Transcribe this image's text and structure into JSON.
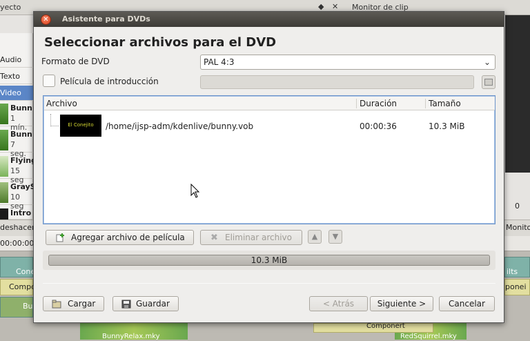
{
  "background": {
    "project_title": "yecto",
    "monitor_title": "Monitor de clip",
    "sidebar_items": [
      "Audio",
      "Texto",
      "Video"
    ],
    "clips": [
      {
        "name": "Bunn",
        "duration": "1 mín."
      },
      {
        "name": "Bunn",
        "duration": "7 seg."
      },
      {
        "name": "Flying",
        "duration": "15 seg"
      },
      {
        "name": "GraySl",
        "duration": "10 seg"
      },
      {
        "name": "Intro",
        "duration": ""
      }
    ],
    "undo_label": "deshacer",
    "monitor_tab": "Monito",
    "timecode": "00:00:00",
    "right_counter": "0",
    "track_labels": [
      "Cone",
      "Compo",
      "Bu",
      "BunnyRelax.mky",
      "RedSquirrel.mky",
      "Componert",
      "ponei",
      "ilts"
    ]
  },
  "dialog": {
    "title": "Asistente para DVDs",
    "heading": "Seleccionar archivos para el DVD",
    "format_label": "Formato de DVD",
    "format_value": "PAL 4:3",
    "intro_label": "Película de introducción",
    "intro_checked": false,
    "columns": {
      "file": "Archivo",
      "duration": "Duración",
      "size": "Tamaño"
    },
    "files": [
      {
        "thumb_text": "El Conejito",
        "path": "/home/ijsp-adm/kdenlive/bunny.vob",
        "duration": "00:00:36",
        "size": "10.3 MiB"
      }
    ],
    "add_file": "Agregar archivo de película",
    "remove_file": "Eliminar archivo",
    "total_size": "10.3 MiB",
    "load": "Cargar",
    "save": "Guardar",
    "back": "< Atrás",
    "next": "Siguiente >",
    "cancel": "Cancelar"
  },
  "colors": {
    "accent": "#5b86c7",
    "list_border": "#6a93c9",
    "titlebar": "#3d3b37",
    "close": "#d8421e"
  }
}
